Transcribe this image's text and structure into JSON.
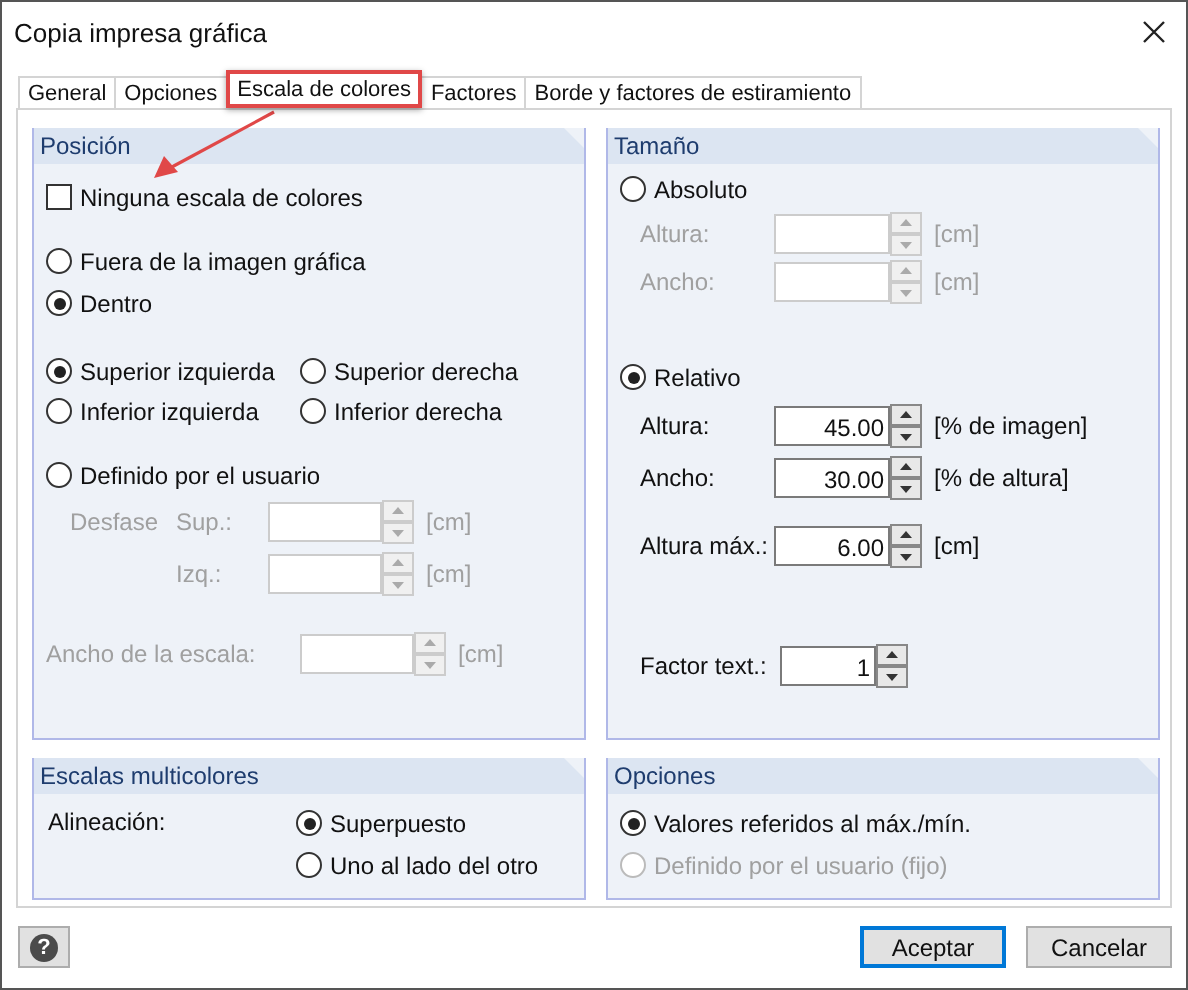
{
  "window": {
    "title": "Copia impresa gráfica"
  },
  "tabs": [
    {
      "label": "General",
      "selected": false,
      "highlighted": false
    },
    {
      "label": "Opciones",
      "selected": false,
      "highlighted": false
    },
    {
      "label": "Escala de colores",
      "selected": true,
      "highlighted": true
    },
    {
      "label": "Factores",
      "selected": false,
      "highlighted": false
    },
    {
      "label": "Borde y factores de estiramiento",
      "selected": false,
      "highlighted": false
    }
  ],
  "annotation_arrow": true,
  "position": {
    "title": "Posición",
    "no_scale": {
      "label": "Ninguna escala de colores",
      "checked": false
    },
    "placement": [
      {
        "label": "Fuera de la imagen gráfica",
        "selected": false
      },
      {
        "label": "Dentro",
        "selected": true
      }
    ],
    "corners": [
      {
        "label": "Superior izquierda",
        "selected": true
      },
      {
        "label": "Superior derecha",
        "selected": false
      },
      {
        "label": "Inferior izquierda",
        "selected": false
      },
      {
        "label": "Inferior derecha",
        "selected": false
      }
    ],
    "user_defined": {
      "label": "Definido por el usuario",
      "selected": false
    },
    "offset_label": "Desfase",
    "offset_fields": [
      {
        "label": "Sup.:",
        "unit": "[cm]",
        "disabled": true
      },
      {
        "label": "Izq.:",
        "unit": "[cm]",
        "disabled": true
      }
    ],
    "scale_width": {
      "label": "Ancho de la escala:",
      "unit": "[cm]",
      "disabled": true
    }
  },
  "size": {
    "title": "Tamaño",
    "absolute": {
      "label": "Absoluto",
      "selected": false
    },
    "absolute_fields": [
      {
        "label": "Altura:",
        "unit": "[cm]",
        "disabled": true
      },
      {
        "label": "Ancho:",
        "unit": "[cm]",
        "disabled": true
      }
    ],
    "relative": {
      "label": "Relativo",
      "selected": true
    },
    "relative_fields": [
      {
        "label": "Altura:",
        "value": "45.00",
        "unit": "[% de imagen]",
        "disabled": false
      },
      {
        "label": "Ancho:",
        "value": "30.00",
        "unit": "[% de altura]",
        "disabled": false
      },
      {
        "label": "Altura máx.:",
        "value": "6.00",
        "unit": "[cm]",
        "disabled": false
      }
    ],
    "text_factor": {
      "label": "Factor text.:",
      "value": "1"
    }
  },
  "multicolor": {
    "title": "Escalas multicolores",
    "alignment_label": "Alineación:",
    "options": [
      {
        "label": "Superpuesto",
        "selected": true
      },
      {
        "label": "Uno al lado del otro",
        "selected": false
      }
    ]
  },
  "options": {
    "title": "Opciones",
    "items": [
      {
        "label": "Valores referidos al máx./mín.",
        "selected": true,
        "disabled": false
      },
      {
        "label": "Definido por el usuario (fijo)",
        "selected": false,
        "disabled": true
      }
    ]
  },
  "help": "?",
  "buttons": [
    {
      "label": "Aceptar",
      "default": true
    },
    {
      "label": "Cancelar",
      "default": false
    }
  ]
}
